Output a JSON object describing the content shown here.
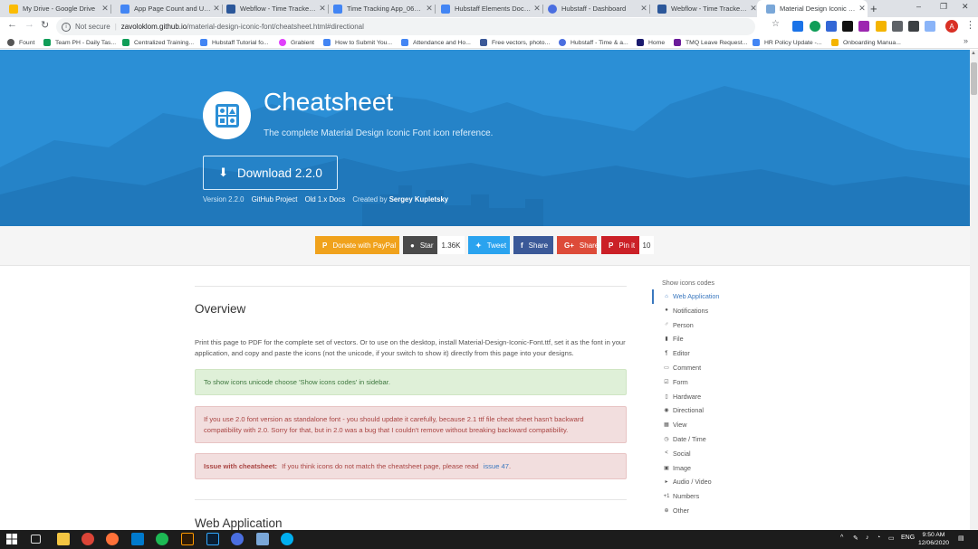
{
  "browser": {
    "tabs": [
      {
        "title": "My Drive - Google Drive",
        "favicon": "google-drive-icon",
        "color": "#fbbc04"
      },
      {
        "title": "App Page Count and Uniqu",
        "favicon": "docs-icon",
        "color": "#4285f4"
      },
      {
        "title": "Webflow - Time Tracker Wé",
        "favicon": "word-icon",
        "color": "#2b579a"
      },
      {
        "title": "Time Tracking App_060920",
        "favicon": "docs-icon",
        "color": "#4285f4"
      },
      {
        "title": "Hubstaff Elements Docume",
        "favicon": "docs-icon",
        "color": "#4285f4"
      },
      {
        "title": "Hubstaff - Dashboard",
        "favicon": "hubstaff-icon",
        "color": "#4a6ee0"
      },
      {
        "title": "Webflow - Time Tracker Wé",
        "favicon": "word-icon",
        "color": "#2b579a"
      },
      {
        "title": "Material Design Iconic Font",
        "favicon": "material-icon",
        "color": "#7aa7d8"
      }
    ],
    "new_tab": "+",
    "window_controls": {
      "minimize": "–",
      "restore": "❐",
      "close": "✕"
    },
    "toolbar": {
      "not_secure": "Not secure",
      "host": "zavoloklom.github.io",
      "path": "/material-design-iconic-font/cheatsheet.html#directional",
      "profile_initial": "A"
    },
    "bookmarks": [
      {
        "label": "Fount",
        "color": "#555555"
      },
      {
        "label": "Team PH - Daily Tas...",
        "color": "#0f9d58"
      },
      {
        "label": "Centralized Training...",
        "color": "#0f9d58"
      },
      {
        "label": "Hubstaff Tutorial fo...",
        "color": "#4285f4"
      },
      {
        "label": "Grabient",
        "color": "#e040fb"
      },
      {
        "label": "How to Submit You...",
        "color": "#4285f4"
      },
      {
        "label": "Attendance and Ho...",
        "color": "#4285f4"
      },
      {
        "label": "Free vectors, photo...",
        "color": "#3b5998"
      },
      {
        "label": "Hubstaff - Time & a...",
        "color": "#4a6ee0"
      },
      {
        "label": "Home",
        "color": "#1a1a6e"
      },
      {
        "label": "TMQ Leave Request...",
        "color": "#6a1b9a"
      },
      {
        "label": "HR Policy Update -...",
        "color": "#4285f4"
      },
      {
        "label": "Onboarding Manua...",
        "color": "#f4b400"
      }
    ],
    "bookmarks_more": "»"
  },
  "hero": {
    "title": "Cheatsheet",
    "subtitle": "The complete Material Design Iconic Font icon reference.",
    "download_label": "Download 2.2.0",
    "version": "Version 2.2.0",
    "links": [
      "GitHub Project",
      "Old 1.x Docs"
    ],
    "created_by_prefix": "Created by",
    "created_by_name": "Sergey Kupletsky",
    "background": "#2b8fd6"
  },
  "social": {
    "paypal": "Donate with PayPal",
    "star": "Star",
    "star_count": "1.36K",
    "tweet": "Tweet",
    "facebook": "Share",
    "google": "Share",
    "pinterest": "Pin it",
    "pin_count": "10"
  },
  "main": {
    "overview_title": "Overview",
    "overview_text": "Print this page to PDF for the complete set of vectors. Or to use on the desktop, install Material-Design-Iconic-Font.ttf, set it as the font in your application, and copy and paste the icons (not the unicode, if your switch to show it) directly from this page into your designs.",
    "alert_success": "To show icons unicode choose 'Show icons codes' in sidebar.",
    "alert_warn": "If you use 2.0 font version as standalone font - you should update it carefully, because 2.1 ttf file cheat sheet hasn't backward compatibility with 2.0. Sorry for that, but in 2.0 was a bug that I couldn't remove without breaking backward compatibility.",
    "alert_issue_bold": "Issue with cheatsheet:",
    "alert_issue_text": "If you think icons do not match the cheatsheet page, please read",
    "alert_issue_link": "issue 47",
    "alert_issue_end": ".",
    "section_title": "Web Application"
  },
  "sidebar": {
    "title": "Show icons codes",
    "items": [
      {
        "label": "Web Application",
        "icon": "home-icon",
        "glyph": "⌂"
      },
      {
        "label": "Notifications",
        "icon": "alert-circle-icon",
        "glyph": "●"
      },
      {
        "label": "Person",
        "icon": "person-icon",
        "glyph": "♂"
      },
      {
        "label": "File",
        "icon": "file-icon",
        "glyph": "▮"
      },
      {
        "label": "Editor",
        "icon": "editor-icon",
        "glyph": "¶"
      },
      {
        "label": "Comment",
        "icon": "comment-icon",
        "glyph": "▭"
      },
      {
        "label": "Form",
        "icon": "checkbox-icon",
        "glyph": "☑"
      },
      {
        "label": "Hardware",
        "icon": "phone-icon",
        "glyph": "▯"
      },
      {
        "label": "Directional",
        "icon": "directional-icon",
        "glyph": "◉"
      },
      {
        "label": "View",
        "icon": "view-module-icon",
        "glyph": "▦"
      },
      {
        "label": "Date / Time",
        "icon": "clock-icon",
        "glyph": "◷"
      },
      {
        "label": "Social",
        "icon": "share-icon",
        "glyph": "<"
      },
      {
        "label": "Image",
        "icon": "image-icon",
        "glyph": "▣"
      },
      {
        "label": "Audio / Video",
        "icon": "volume-icon",
        "glyph": "▸"
      },
      {
        "label": "Numbers",
        "icon": "numbers-icon",
        "glyph": "+1"
      },
      {
        "label": "Other",
        "icon": "other-icon",
        "glyph": "⊕"
      }
    ],
    "active_index": 0,
    "accent": "#3a78bf"
  },
  "taskbar": {
    "time": "9:50 AM",
    "date": "12/06/2020",
    "language": "ENG"
  }
}
